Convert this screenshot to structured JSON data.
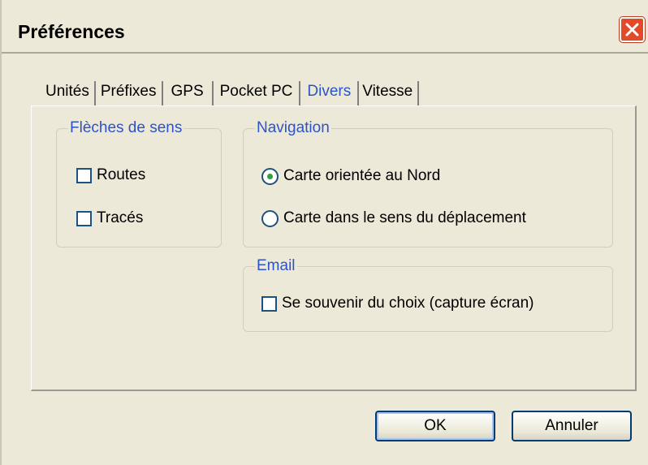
{
  "window": {
    "title": "Préférences"
  },
  "tabs": [
    {
      "label": "Unités"
    },
    {
      "label": "Préfixes"
    },
    {
      "label": "GPS"
    },
    {
      "label": "Pocket PC"
    },
    {
      "label": "Divers",
      "active": true
    },
    {
      "label": "Vitesse"
    }
  ],
  "fleches": {
    "legend": "Flèches de sens",
    "items": [
      {
        "label": "Routes",
        "checked": false
      },
      {
        "label": "Tracés",
        "checked": false
      }
    ]
  },
  "navigation": {
    "legend": "Navigation",
    "options": [
      {
        "label": "Carte orientée au Nord",
        "selected": true
      },
      {
        "label": "Carte dans le sens du déplacement",
        "selected": false
      }
    ]
  },
  "email": {
    "legend": "Email",
    "remember_label": "Se souvenir du choix (capture écran)",
    "remember_checked": false
  },
  "buttons": {
    "ok_label": "OK",
    "cancel_label": "Annuler"
  },
  "colors": {
    "accent_blue": "#2d53c9",
    "close_red": "#e24a2a",
    "radio_dot_green": "#2ea33a"
  }
}
